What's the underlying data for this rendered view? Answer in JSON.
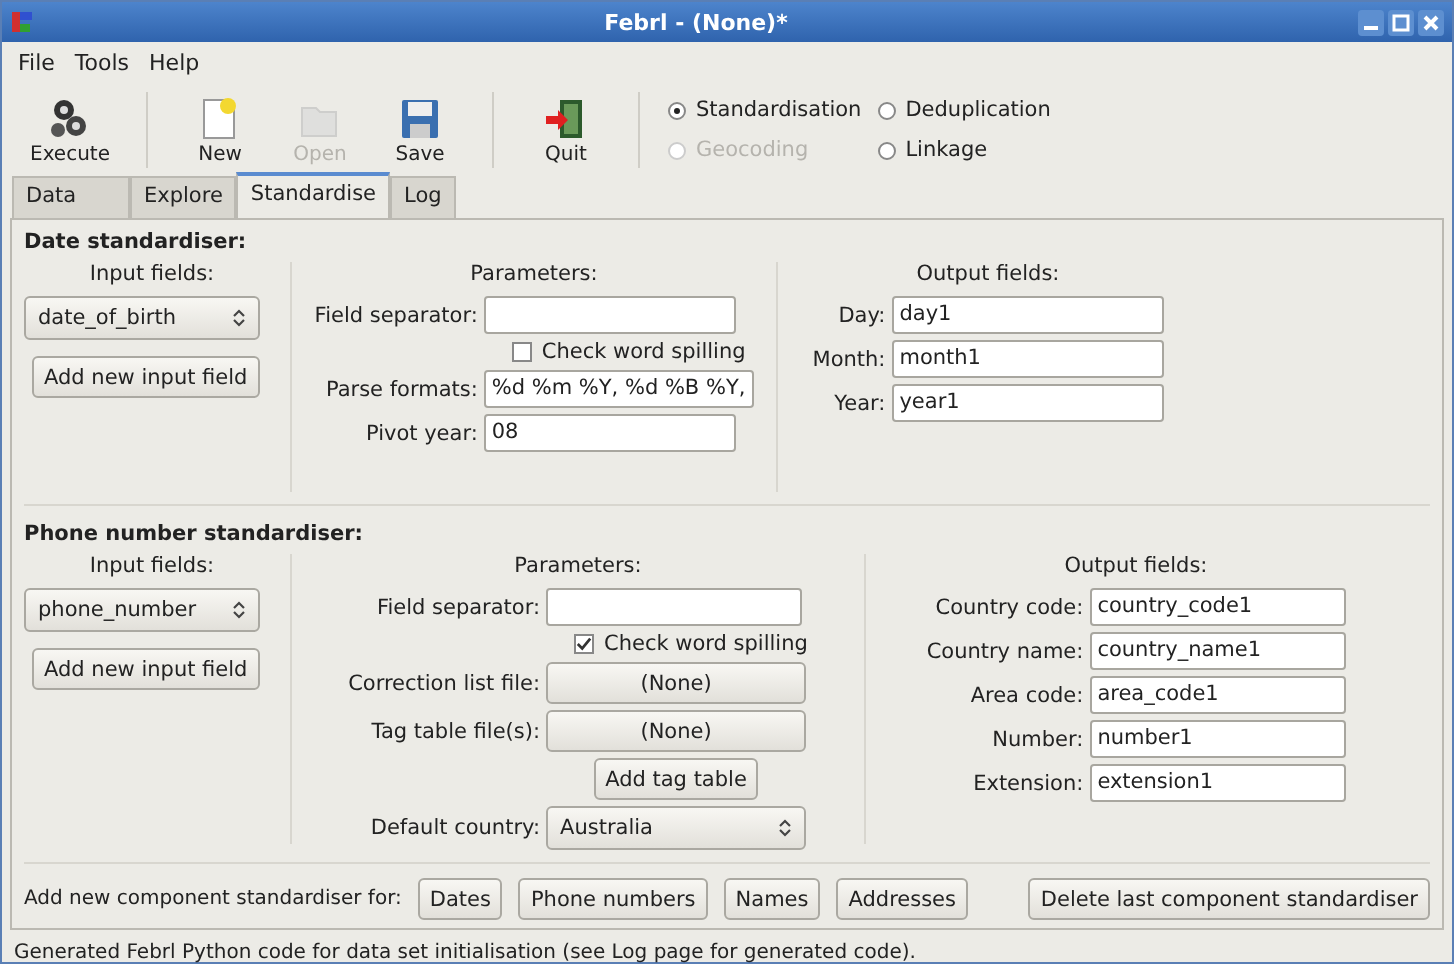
{
  "window": {
    "title": "Febrl - (None)*"
  },
  "menu": [
    "File",
    "Tools",
    "Help"
  ],
  "toolbar": {
    "buttons": [
      {
        "label": "Execute",
        "kind": "execute",
        "disabled": false
      },
      {
        "label": "New",
        "kind": "new",
        "disabled": false
      },
      {
        "label": "Open",
        "kind": "open",
        "disabled": true
      },
      {
        "label": "Save",
        "kind": "save",
        "disabled": false
      },
      {
        "label": "Quit",
        "kind": "quit",
        "disabled": false
      }
    ],
    "modes": [
      {
        "label": "Standardisation",
        "selected": true,
        "disabled": false
      },
      {
        "label": "Deduplication",
        "selected": false,
        "disabled": false
      },
      {
        "label": "Geocoding",
        "selected": false,
        "disabled": true
      },
      {
        "label": "Linkage",
        "selected": false,
        "disabled": false
      }
    ]
  },
  "tabs": [
    {
      "label": "Data",
      "selected": false
    },
    {
      "label": "Explore",
      "selected": false
    },
    {
      "label": "Standardise",
      "selected": true
    },
    {
      "label": "Log",
      "selected": false
    }
  ],
  "sections": [
    {
      "title": "Date standardiser:",
      "kind": "date",
      "input": {
        "title": "Input fields:",
        "value": "date_of_birth",
        "button": "Add new input field"
      },
      "parameters": {
        "title": "Parameters:",
        "rows": [
          {
            "kind": "text",
            "label": "Field separator:"
          },
          {
            "kind": "checkbox",
            "label": "Check word spilling",
            "checked": false
          },
          {
            "kind": "text",
            "label": "Parse formats:",
            "value": "%d %m %Y, %d %B %Y,"
          },
          {
            "kind": "text",
            "label": "Pivot year:",
            "value": "08"
          }
        ]
      },
      "output": {
        "title": "Output fields:",
        "rows": [
          {
            "label": "Day:",
            "value": "day1"
          },
          {
            "label": "Month:",
            "value": "month1"
          },
          {
            "label": "Year:",
            "value": "year1"
          }
        ]
      }
    },
    {
      "title": "Phone number standardiser:",
      "kind": "phone",
      "input": {
        "title": "Input fields:",
        "value": "phone_number",
        "button": "Add new input field"
      },
      "parameters": {
        "title": "Parameters:",
        "rows": [
          {
            "kind": "text",
            "label": "Field separator:"
          },
          {
            "kind": "checkbox",
            "label": "Check word spilling",
            "checked": true
          },
          {
            "kind": "file",
            "label": "Correction list file:",
            "value": "(None)"
          },
          {
            "kind": "file",
            "label": "Tag table file(s):",
            "value": "(None)"
          },
          {
            "kind": "button",
            "label": "Add tag table"
          },
          {
            "kind": "select",
            "label": "Default country:",
            "value": "Australia"
          }
        ]
      },
      "output": {
        "title": "Output fields:",
        "rows": [
          {
            "label": "Country code:",
            "value": "country_code1"
          },
          {
            "label": "Country name:",
            "value": "country_name1"
          },
          {
            "label": "Area code:",
            "value": "area_code1"
          },
          {
            "label": "Number:",
            "value": "number1"
          },
          {
            "label": "Extension:",
            "value": "extension1"
          }
        ]
      }
    }
  ],
  "add_bar": {
    "label": "Add new component standardiser for:",
    "buttons": [
      "Dates",
      "Phone numbers",
      "Names",
      "Addresses"
    ],
    "delete_button": "Delete last component standardiser"
  },
  "status_bar": "Generated Febrl Python code for data set initialisation (see Log page for generated code)."
}
